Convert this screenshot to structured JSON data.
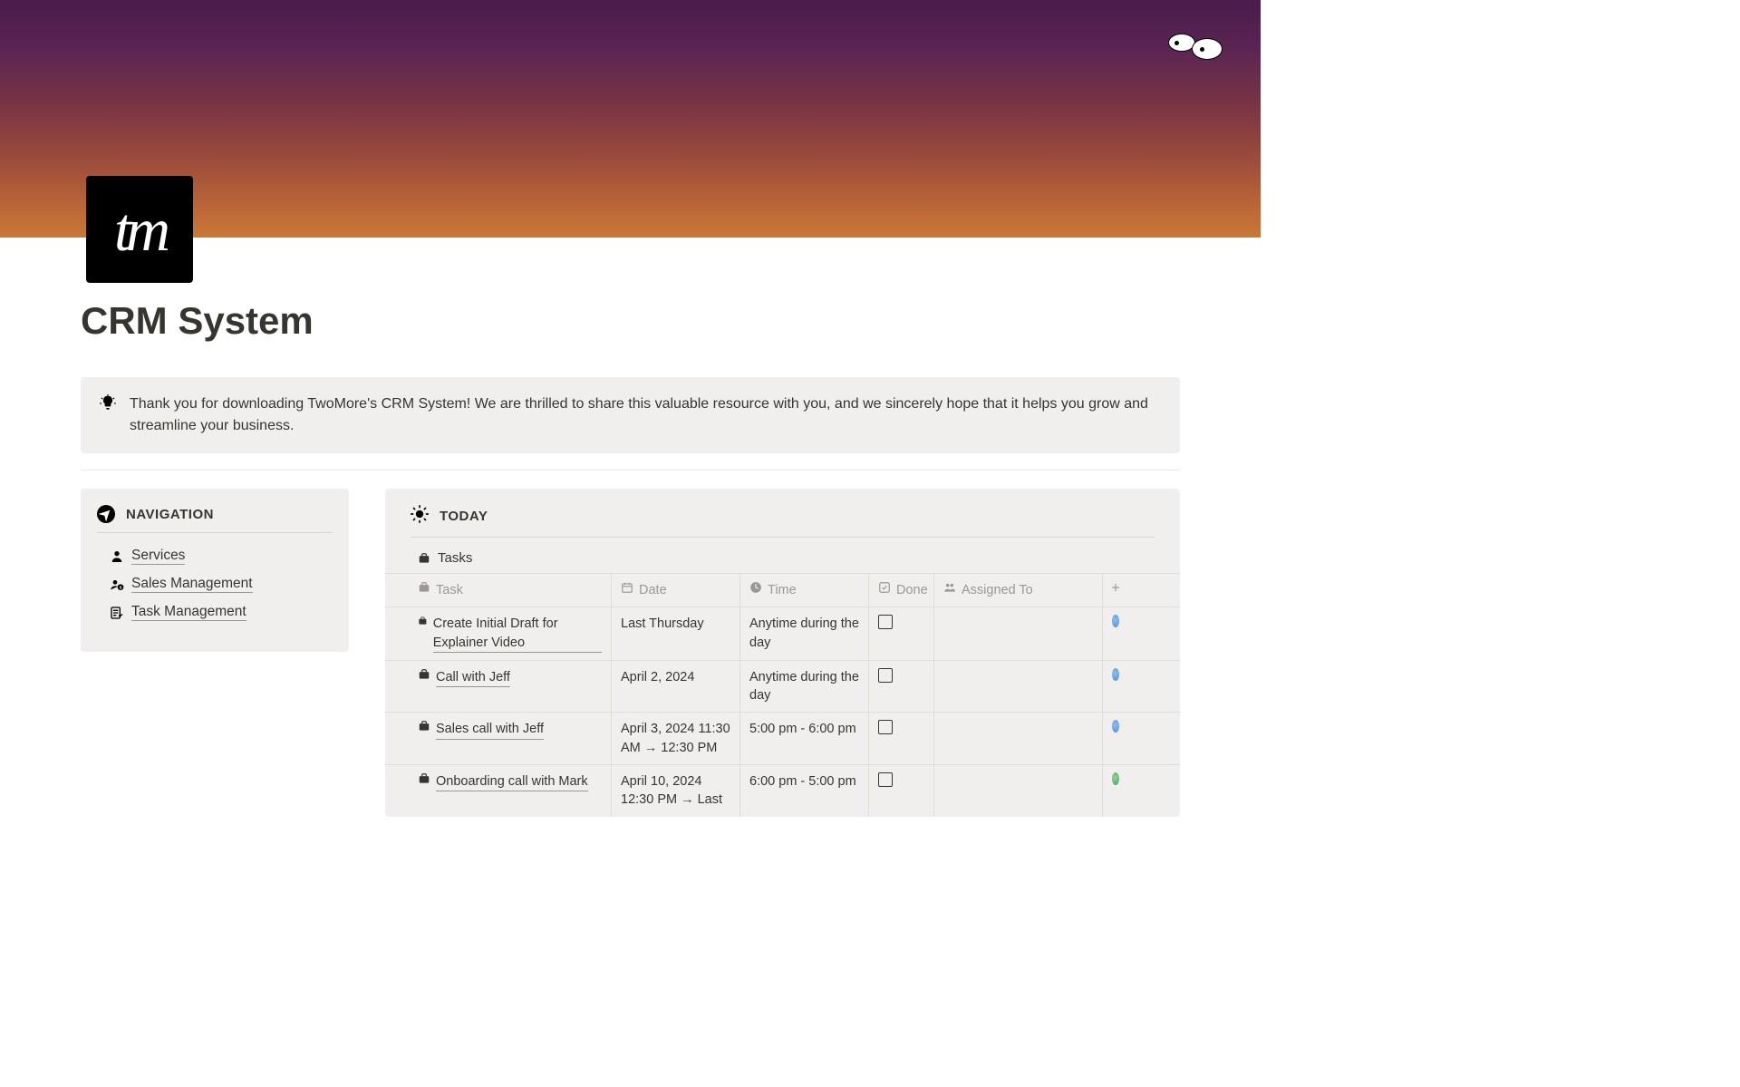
{
  "logo_text": "tm",
  "page_title": "CRM System",
  "callout_text": "Thank you for downloading TwoMore's CRM System! We are thrilled to share this valuable resource with you, and we sincerely hope that it helps you grow and streamline your business.",
  "sidebar": {
    "title": "NAVIGATION",
    "items": [
      {
        "label": "Services"
      },
      {
        "label": "Sales Management"
      },
      {
        "label": "Task Management"
      }
    ]
  },
  "today": {
    "title": "TODAY",
    "tab_label": "Tasks",
    "columns": {
      "task": "Task",
      "date": "Date",
      "time": "Time",
      "done": "Done",
      "assigned": "Assigned To"
    },
    "rows": [
      {
        "task": "Create Initial Draft for Explainer Video",
        "date": "Last Thursday",
        "time": "Anytime during the day",
        "dot": "blue"
      },
      {
        "task": "Call with Jeff",
        "date": "April 2, 2024",
        "time": "Anytime during the day",
        "dot": "blue"
      },
      {
        "task": "Sales call with Jeff",
        "date": "April 3, 2024 11:30 AM → 12:30 PM",
        "time": "5:00 pm - 6:00 pm",
        "dot": "blue"
      },
      {
        "task": "Onboarding call with Mark",
        "date": "April 10, 2024 12:30 PM → Last",
        "time": "6:00 pm - 5:00 pm",
        "dot": "green"
      }
    ]
  }
}
